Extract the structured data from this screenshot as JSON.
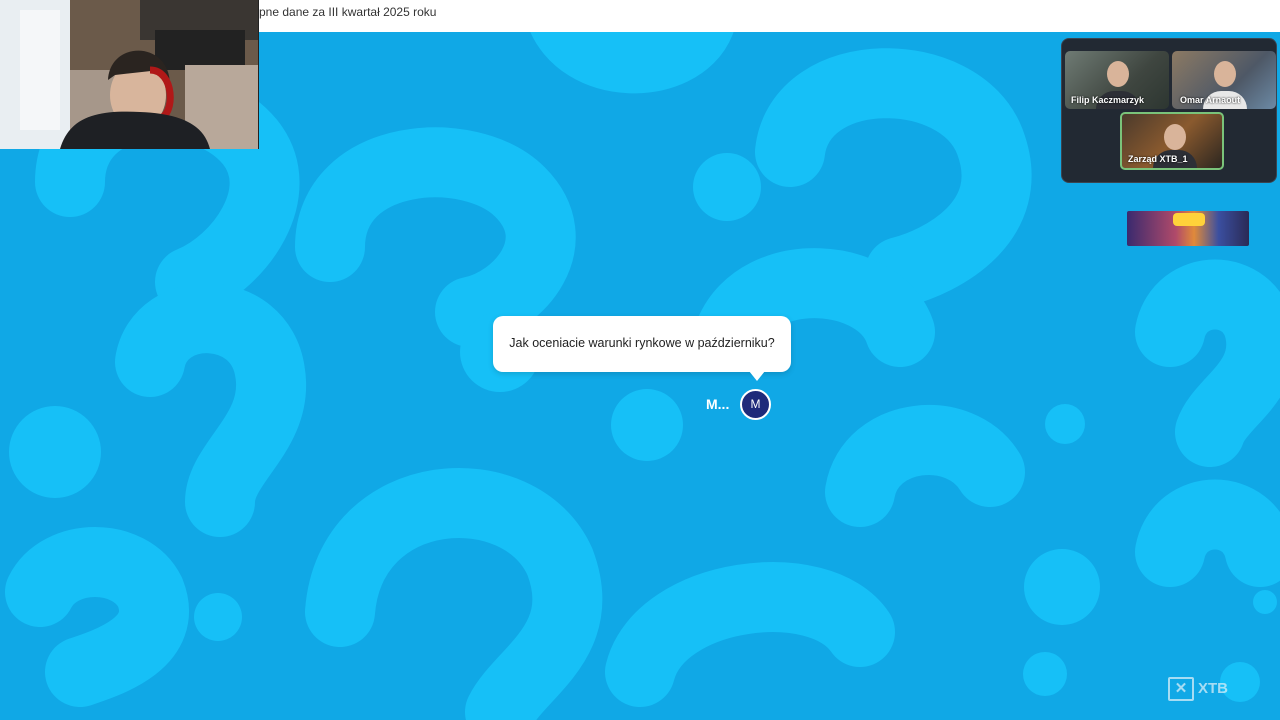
{
  "topbar": {
    "title": "pne dane za III kwartał 2025 roku"
  },
  "participants": [
    {
      "name": "Filip Kaczmarzyk"
    },
    {
      "name": "Omar Arnaout"
    },
    {
      "name": "Zarząd XTB_1"
    }
  ],
  "question": {
    "text": "Jak oceniacie warunki rynkowe w październiku?",
    "author_name": "M...",
    "author_initial": "M"
  },
  "logo": {
    "icon": "xtb-logo-icon",
    "text": "XTB"
  },
  "colors": {
    "background": "#10a8e6",
    "pattern": "#16c0f7",
    "avatar": "#1f2a7a"
  }
}
